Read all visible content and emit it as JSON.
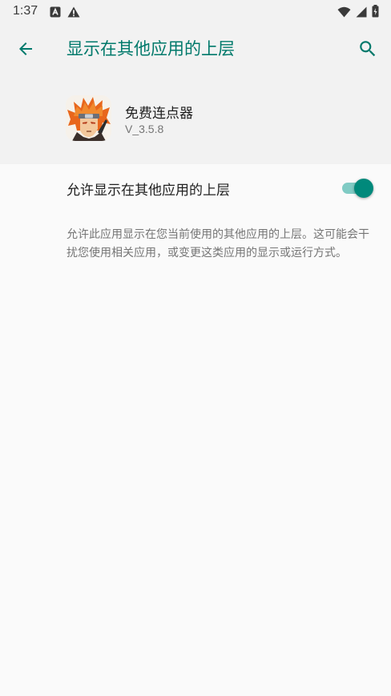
{
  "status_bar": {
    "time": "1:37",
    "left_icons": [
      "app-notification-icon",
      "warning-icon"
    ],
    "right_icons": [
      "wifi-icon",
      "signal-icon",
      "battery-icon"
    ]
  },
  "toolbar": {
    "title": "显示在其他应用的上层",
    "back_icon": "arrow-back-icon",
    "search_icon": "search-icon"
  },
  "app": {
    "name": "免费连点器",
    "version": "V_3.5.8",
    "icon": "app-icon"
  },
  "setting": {
    "label": "允许显示在其他应用的上层",
    "enabled": true
  },
  "description": "允许此应用显示在您当前使用的其他应用的上层。这可能会干扰您使用相关应用，或变更这类应用的显示或运行方式。",
  "colors": {
    "accent": "#00796b",
    "toggle_thumb": "#00897b",
    "toggle_track": "#80cbc4",
    "header_bg": "#f2f2f2",
    "page_bg": "#fafafa"
  }
}
